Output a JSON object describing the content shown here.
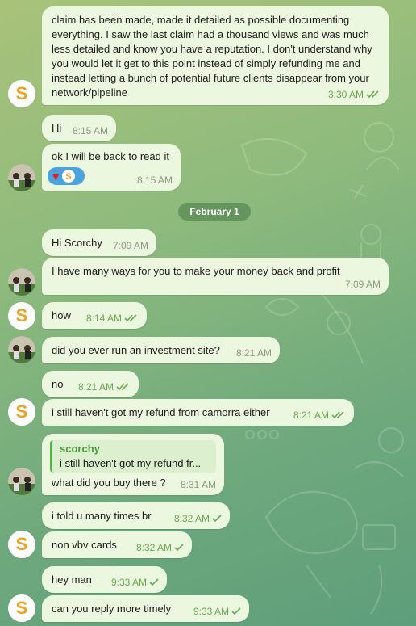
{
  "date_divider": "February 1",
  "quote": {
    "author": "scorchy",
    "text": "i still haven't got my refund fr..."
  },
  "messages": [
    {
      "text": "claim has been made, made it detailed as possible documenting everything. I saw the last claim had a thousand views and was much less detailed and know you have a reputation. I don't understand why you would let it get to this point instead of simply refunding me and instead letting a bunch of potential  future clients disappear from your network/pipeline",
      "time": "3:30 AM"
    },
    {
      "text": "Hi",
      "time": "8:15 AM"
    },
    {
      "text": "ok I will be back to read it",
      "time": "8:15 AM"
    },
    {
      "text": "Hi Scorchy",
      "time": "7:09 AM"
    },
    {
      "text": "I have many ways for you to make your money back and profit",
      "time": "7:09 AM"
    },
    {
      "text": "how",
      "time": "8:14 AM"
    },
    {
      "text": "did you ever run an investment site?",
      "time": "8:21 AM"
    },
    {
      "text": "no",
      "time": "8:21 AM"
    },
    {
      "text": "i still haven't got my refund from camorra either",
      "time": "8:21 AM"
    },
    {
      "text": "what did you buy there ?",
      "time": "8:31 AM"
    },
    {
      "text": "i told u many times br",
      "time": "8:32 AM"
    },
    {
      "text": "non vbv cards",
      "time": "8:32 AM"
    },
    {
      "text": "hey man",
      "time": "9:33 AM"
    },
    {
      "text": "can you reply more timely",
      "time": "9:33 AM"
    }
  ],
  "icons": {
    "avatar_self": "s-logo-avatar",
    "avatar_other": "profile-photo-avatar",
    "read_receipt": "double-check-icon",
    "sent_receipt": "single-check-icon",
    "reaction_1": "red-heart",
    "reaction_2": "s-logo-avatar"
  },
  "colors": {
    "bubble": "#ecf7df",
    "time_green": "#6aa84f",
    "time_gray": "#8a9a80",
    "date_pill": "#5f8f5f",
    "quote_bar": "#5aae4a",
    "reaction_bg": "#4aa3df"
  }
}
